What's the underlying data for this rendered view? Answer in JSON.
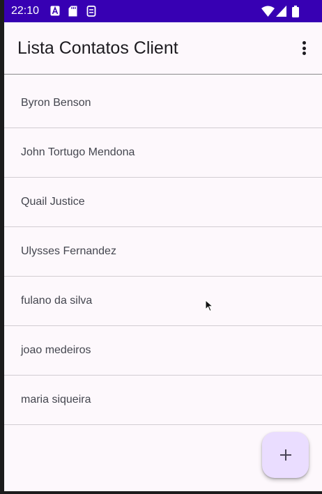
{
  "status_bar": {
    "time": "22:10",
    "left_icons": [
      "accessibility-icon",
      "sd-card-icon",
      "sim-icon"
    ],
    "right_icons": [
      "wifi-icon",
      "cellular-signal-icon",
      "battery-icon"
    ],
    "background": "#3700b3"
  },
  "app_bar": {
    "title": "Lista Contatos Client",
    "menu_icon": "more-vert-icon"
  },
  "contacts": [
    "Byron Benson",
    "John Tortugo Mendona",
    "Quail Justice",
    "Ulysses Fernandez",
    "fulano da silva",
    "joao medeiros",
    "maria siqueira"
  ],
  "fab": {
    "icon": "plus-icon",
    "symbol": "+",
    "background": "#eaddff"
  },
  "colors": {
    "surface": "#fdf8fc",
    "text_primary": "#1d1b20",
    "text_secondary": "#44464f",
    "divider": "#d2cdd2"
  }
}
